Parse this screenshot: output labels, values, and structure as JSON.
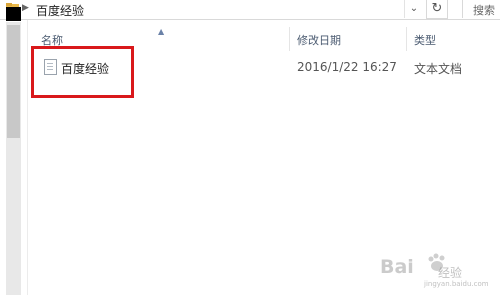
{
  "address_bar": {
    "path": "百度经验",
    "search_placeholder": "搜索"
  },
  "columns": {
    "name": "名称",
    "date_modified": "修改日期",
    "type": "类型"
  },
  "files": [
    {
      "name": "百度经验",
      "date_modified": "2016/1/22 16:27",
      "type": "文本文档"
    }
  ],
  "watermark": {
    "brand": "Bai",
    "brand_suffix": "经验",
    "url": "jingyan.baidu.com"
  },
  "colors": {
    "highlight": "#d9181b",
    "folder": "#e8b84a"
  }
}
